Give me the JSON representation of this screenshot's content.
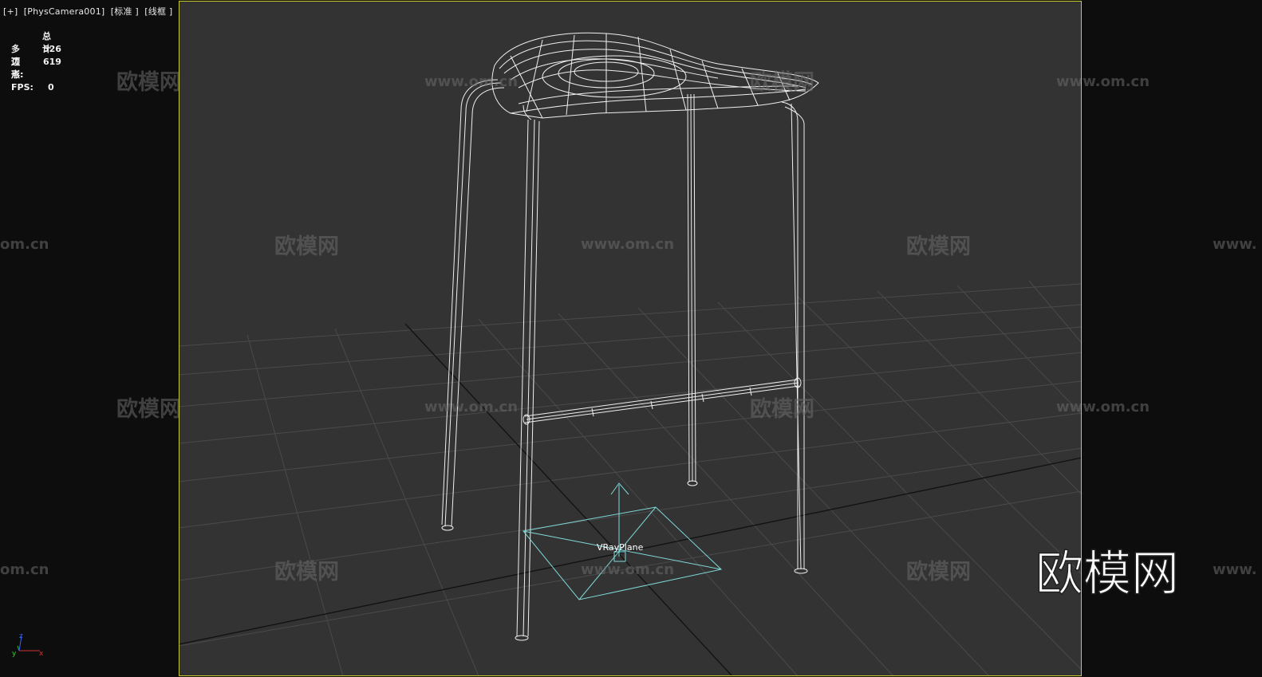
{
  "viewport": {
    "label": "[+]  [PhysCamera001]  [标准 ]  [线框 ]",
    "border_color": "#c8c832",
    "background_color": "#333333"
  },
  "stats": {
    "header": "总计",
    "polygons_label": "多边形:",
    "polygons_value": "526",
    "vertices_label": "顶点:",
    "vertices_value": "619",
    "fps_label": "FPS:",
    "fps_value": "0"
  },
  "scene": {
    "object_label": "VRayPlane",
    "object_color": "#7fd8d8",
    "wireframe_color": "#ffffff"
  },
  "axis_gizmo": {
    "x": "x",
    "y": "y",
    "z": "z"
  },
  "watermarks": {
    "cn_text": "欧模网",
    "url_text": "www.om.cn",
    "url_partial_left": "om.cn",
    "url_partial_right": "www.",
    "big_text": "欧模网"
  }
}
